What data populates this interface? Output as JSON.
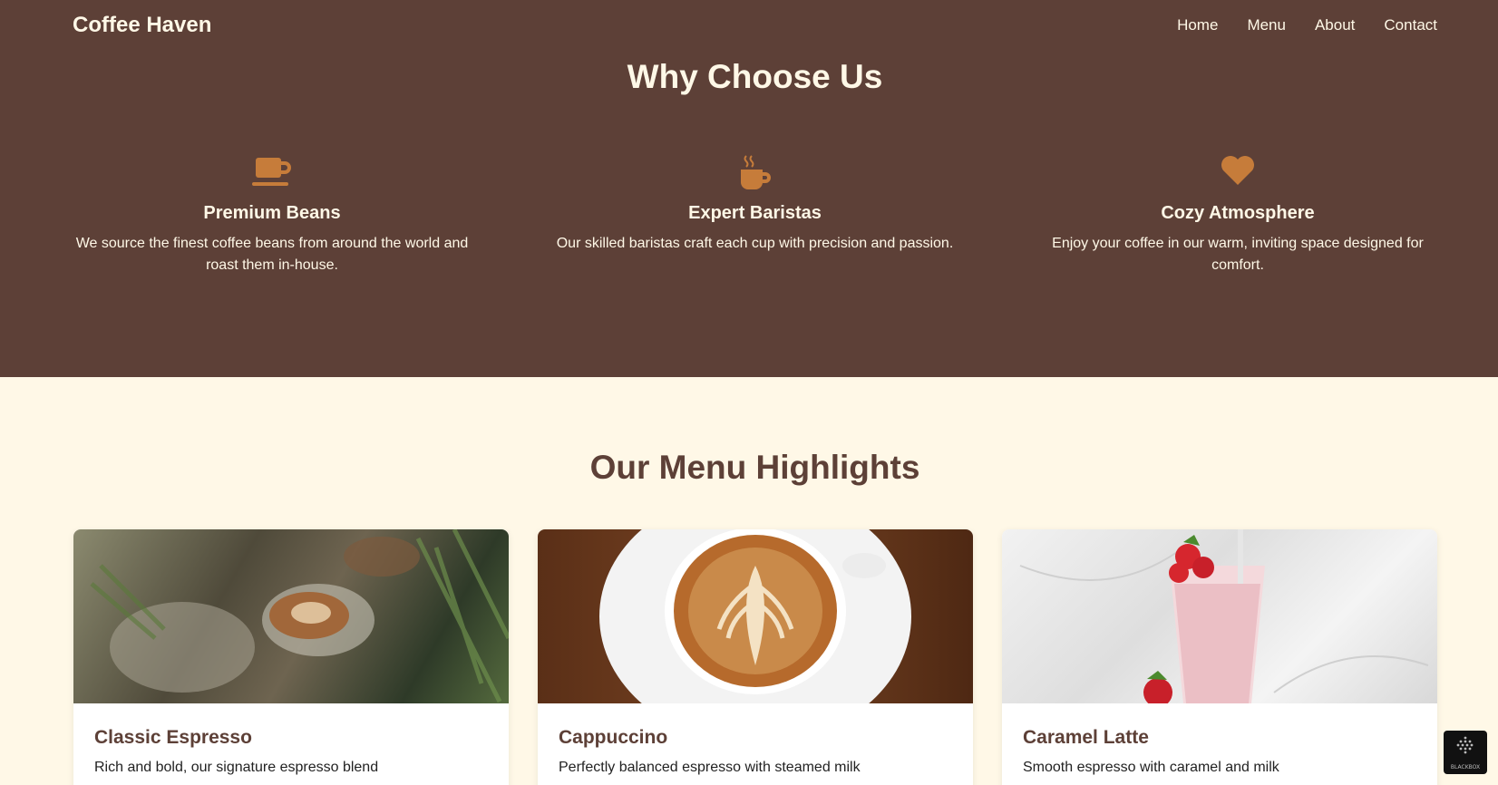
{
  "navbar": {
    "brand": "Coffee Haven",
    "links": [
      "Home",
      "Menu",
      "About",
      "Contact"
    ]
  },
  "why": {
    "title": "Why Choose Us",
    "features": [
      {
        "icon": "mug-icon",
        "title": "Premium Beans",
        "desc": "We source the finest coffee beans from around the world and roast them in-house."
      },
      {
        "icon": "hot-coffee-icon",
        "title": "Expert Baristas",
        "desc": "Our skilled baristas craft each cup with precision and passion."
      },
      {
        "icon": "heart-icon",
        "title": "Cozy Atmosphere",
        "desc": "Enjoy your coffee in our warm, inviting space designed for comfort."
      }
    ]
  },
  "menu": {
    "title": "Our Menu Highlights",
    "items": [
      {
        "title": "Classic Espresso",
        "desc": "Rich and bold, our signature espresso blend"
      },
      {
        "title": "Cappuccino",
        "desc": "Perfectly balanced espresso with steamed milk"
      },
      {
        "title": "Caramel Latte",
        "desc": "Smooth espresso with caramel and milk"
      }
    ]
  },
  "widget": {
    "label": "BLACKBOX"
  },
  "colors": {
    "dark_brown": "#5d4037",
    "cream": "#fff8e7",
    "accent": "#c67c3a"
  }
}
